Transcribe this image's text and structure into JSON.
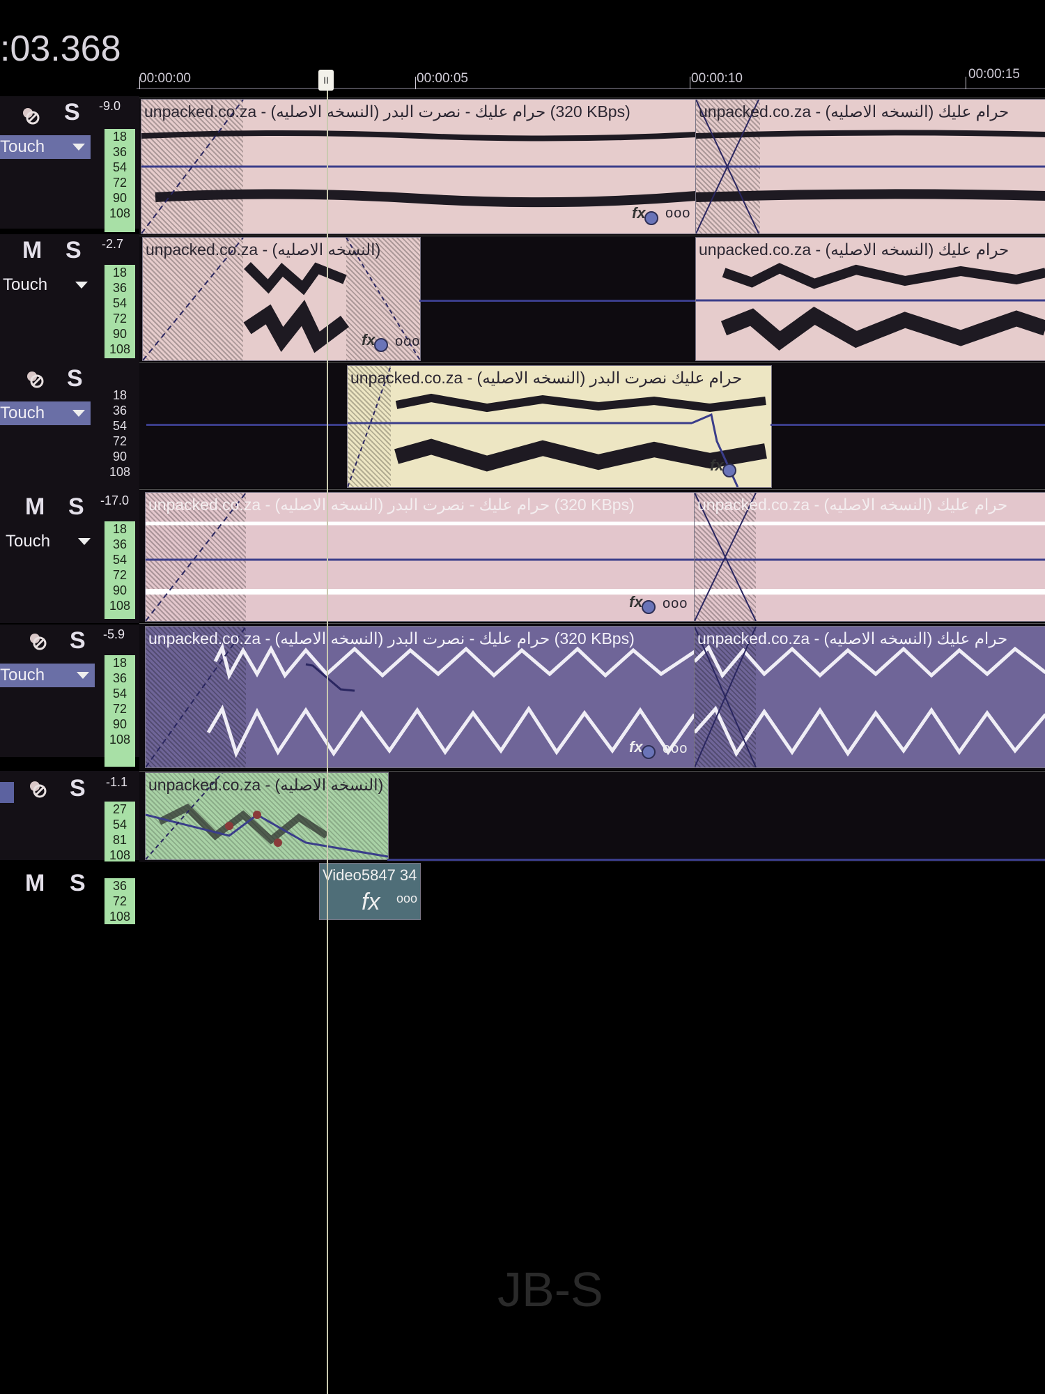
{
  "transport": {
    "timecode": ":03.368"
  },
  "ruler": {
    "labels": [
      "00:00:00",
      "00:00:05",
      "00:00:10",
      "00:00:15"
    ],
    "cursor_marker": "II"
  },
  "tracks": [
    {
      "mute": "",
      "solo": "S",
      "volume": "-9.0",
      "automation": "Touch",
      "meter": [
        "18",
        "36",
        "54",
        "72",
        "90",
        "108"
      ]
    },
    {
      "mute": "M",
      "solo": "S",
      "volume": "-2.7",
      "automation": "Touch",
      "meter": [
        "18",
        "36",
        "54",
        "72",
        "90",
        "108"
      ]
    },
    {
      "mute": "",
      "solo": "S",
      "volume": "",
      "automation": "Touch",
      "meter": [
        "18",
        "36",
        "54",
        "72",
        "90",
        "108"
      ]
    },
    {
      "mute": "M",
      "solo": "S",
      "volume": "-17.0",
      "automation": "Touch",
      "meter": [
        "18",
        "36",
        "54",
        "72",
        "90",
        "108"
      ]
    },
    {
      "mute": "",
      "solo": "S",
      "volume": "-5.9",
      "automation": "Touch",
      "meter": [
        "18",
        "36",
        "54",
        "72",
        "90",
        "108"
      ]
    },
    {
      "mute": "",
      "solo": "S",
      "volume": "-1.1",
      "automation": "",
      "meter": [
        "27",
        "54",
        "81",
        "108"
      ]
    },
    {
      "mute": "M",
      "solo": "S",
      "volume": "",
      "automation": "",
      "meter": [
        "36",
        "72",
        "108"
      ]
    }
  ],
  "clips": {
    "t1a": "unpacked.co.za - (النسخه الاصليه) حرام عليك - نصرت البدر (320 KBps)",
    "t1b": "unpacked.co.za - (النسخه الاصليه) حرام عليك",
    "t2a": "unpacked.co.za - (النسخه الاصليه)",
    "t2b": "unpacked.co.za - (النسخه الاصليه) حرام عليك",
    "t3a": "unpacked.co.za - (النسخه الاصليه) حرام عليك نصرت البدر",
    "t4a": "unpacked.co.za - (النسخه الاصليه) حرام عليك - نصرت البدر (320 KBps)",
    "t4b": "unpacked.co.za - (النسخه الاصليه) حرام عليك",
    "t5a": "unpacked.co.za - (النسخه الاصليه) حرام عليك - نصرت البدر (320 KBps)",
    "t5b": "unpacked.co.za - (النسخه الاصليه) حرام عليك",
    "t6a": "unpacked.co.za - (النسخه الاصليه)",
    "t7a": "Video5847 34"
  },
  "clip_ui": {
    "fx": "fx",
    "more": "ooo"
  },
  "watermark": "JB-S",
  "colors": {
    "pink_clip": "#e8cfcf",
    "cream_clip": "#eee8c6",
    "lilac_clip": "#6f6598",
    "green_clip": "#a9d7a8",
    "envelope": "#3a3d8a"
  }
}
